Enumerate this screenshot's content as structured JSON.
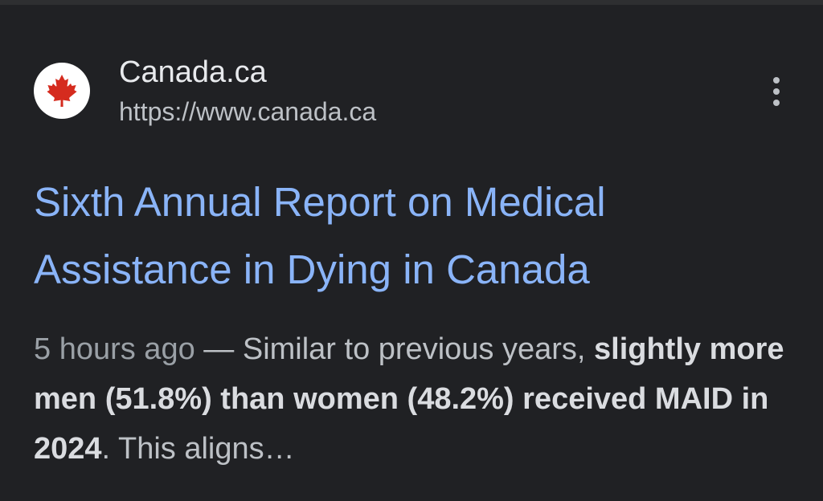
{
  "site": {
    "name": "Canada.ca",
    "url": "https://www.canada.ca",
    "favicon": "canada-maple-leaf-icon",
    "favicon_color": "#d52b1e"
  },
  "more_menu": {
    "icon": "more-vert-icon"
  },
  "result": {
    "title_line1": "Sixth Annual Report on Medical",
    "title_line2": "Assistance in Dying in Canada",
    "title_color": "#8ab4f8"
  },
  "snippet": {
    "date": "5 hours ago",
    "separator": " — ",
    "text_1": "Similar to previous years, ",
    "bold": "slightly more men (51.8%) than women (48.2%) received MAID in 2024",
    "text_2": ". This aligns…"
  },
  "colors": {
    "background": "#202124",
    "site_name": "#e8eaed",
    "url": "#bdc1c6",
    "snippet": "#bdc1c6"
  }
}
